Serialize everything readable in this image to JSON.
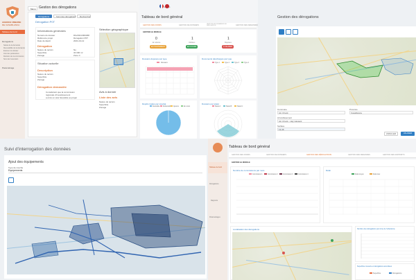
{
  "p1": {
    "logo_lines": [
      "AGENCE URBAINE",
      "DE CASABLANCA"
    ],
    "menu_label": "Menu",
    "page_title": "Gestion des dérogations",
    "sidebar_items": [
      "Tableau de bord",
      "Dérogations",
      "Saisie de la demande",
      "Recevabilité de la demande",
      "Examen du dossier",
      "Avis des partenaires",
      "Décision de la commission",
      "Suivi de l'exécution",
      "Paramétrage"
    ],
    "actions": [
      "Dérogations",
      "Suivi des dérogations",
      "Rechercher"
    ],
    "breadcrumb": "Dérogation P0T",
    "info_title": "Informations générales",
    "info_rows": [
      [
        "Numéro du dossier",
        "DG/2021/000298"
      ],
      [
        "Référence projet",
        "Dérogation P0T"
      ],
      [
        "Date de dépôt",
        "2021-04-12"
      ]
    ],
    "geo_title": "Sélection géographique",
    "sub_sections": [
      "Dérogation",
      "Situation actuelle",
      "Description",
      "Dérogation demandée"
    ],
    "detail_rows": [
      [
        "Nature du terrain",
        "Nu"
      ],
      [
        "Superficie",
        "34 000 m²"
      ],
      [
        "Zonage",
        "Zone C"
      ]
    ],
    "aa_title": "Avis à donner",
    "aa_label": "Liste des avis",
    "text_lines": [
      "Considérant que la commission",
      "régionale d'investissement",
      "a émis un avis favorable au projet"
    ]
  },
  "p2": {
    "lang": "Français",
    "title": "Tableau de bord général",
    "tabs": [
      "GESTION DES FORMS",
      "GESTION DE DOSSIERS",
      "GESTION DES DEMANDES DE DÉROGATION",
      "GESTION DES DEMANDES"
    ],
    "section": "GESTION LE MODULE",
    "stats": [
      {
        "value": "0",
        "label": "En attente",
        "badge": "EN TRAITEMENT",
        "color": "#e8a33a"
      },
      {
        "value": "1",
        "label": "Validées",
        "badge": "EN COURS",
        "color": "#3da35a"
      },
      {
        "value": "1",
        "label": "Rejetées",
        "badge": "À VALIDER",
        "color": "#d9534f"
      }
    ],
    "c1_title": "Dossiers déposés par type",
    "c2_title": "Documents téléchargés par type",
    "c3_title": "Dépôts traités par résultat",
    "c4_title": "Dossiers par statut",
    "c1_legend": "Dossiers",
    "c2_legend": [
      "Type 1",
      "Type 2",
      "Type 3",
      "Type 4"
    ],
    "c3_legend": [
      "Favorable",
      "Défavorable",
      "Ajourné",
      "En cours"
    ],
    "c4_legend": [
      "Statut A",
      "Statut B",
      "Statut C"
    ]
  },
  "p3": {
    "title": "Gestion des dérogations",
    "form_rows": [
      [
        "Commune",
        "Ain Chock"
      ],
      [
        "Province",
        "Casablanca"
      ],
      [
        "Arrondissement",
        "Ain Chock - Hay Hassani"
      ],
      [
        "Surface",
        "13,46"
      ]
    ],
    "btn_cancel": "ANNULER",
    "btn_save": "VALIDER"
  },
  "p4": {
    "title": "Suivi d'interrogation des données",
    "sub": "Ajout des équipements",
    "field_label": "Type de couche",
    "field_value": "Equipements"
  },
  "p5": {
    "title": "Tableau de bord général",
    "sidebar": [
      "Tableau de bord",
      "Dérogations",
      "Rapports",
      "Paramétrages"
    ],
    "tabs": [
      "GESTION DES FORMS",
      "GESTION DE DOSSIERS",
      "GESTION DES DÉROGATIONS",
      "GESTION DES DEMANDES",
      "GESTION DES RAPPORTS"
    ],
    "section": "GESTION LE MODULE",
    "c1_title": "Nombre de commissions par mois",
    "c1_legend": [
      "Commission 1",
      "Commission 2",
      "Commission 3",
      "Commission 4"
    ],
    "c2_title": "Délai",
    "c2_legend": [
      "Délai moyen",
      "Délai max"
    ],
    "map_title": "Localisation des dérogations",
    "c3_title": "Nombre des dérogations par zone de l'urbanisme",
    "c4_title": "Superficie couverte et dérogations accordées",
    "c4_legend": [
      "Superficie",
      "Dérogations"
    ]
  }
}
